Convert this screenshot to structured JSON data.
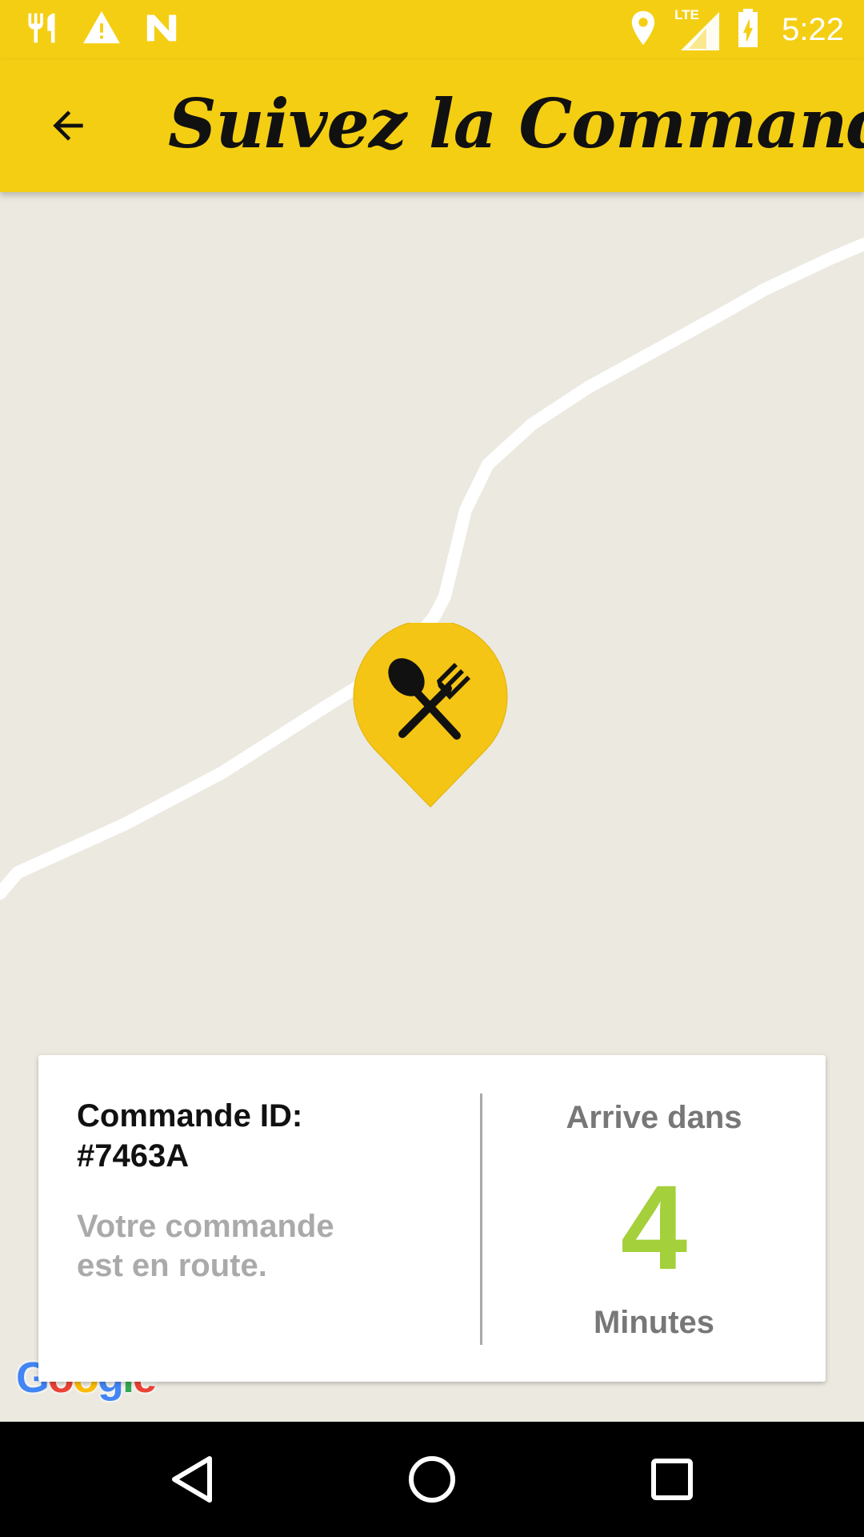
{
  "status_bar": {
    "time": "5:22",
    "network": "LTE",
    "icons": [
      "restaurant-icon",
      "warning-icon",
      "n-logo-icon",
      "location-icon",
      "signal-icon",
      "battery-charging-icon"
    ]
  },
  "app_bar": {
    "title": "Suivez la Commande",
    "back_icon": "arrow-back-icon"
  },
  "map": {
    "marker_icon": "utensils-icon",
    "provider_logo": {
      "letters": [
        "G",
        "o",
        "o",
        "g",
        "l",
        "e"
      ],
      "colors": [
        "#4285F4",
        "#EA4335",
        "#FBBC05",
        "#4285F4",
        "#34A853",
        "#EA4335"
      ]
    }
  },
  "order_card": {
    "order_id_label": "Commande ID:",
    "order_id_value": "#7463A",
    "status_line1": "Votre commande",
    "status_line2": "est en route.",
    "eta_label": "Arrive dans",
    "eta_value": "4",
    "eta_unit": "Minutes"
  },
  "nav_bar": {
    "buttons": [
      "back-triangle-icon",
      "home-circle-icon",
      "recents-square-icon"
    ]
  },
  "colors": {
    "accent": "#f4ce13",
    "map_background": "#ebe9e0",
    "eta_green": "#a4d03b"
  }
}
